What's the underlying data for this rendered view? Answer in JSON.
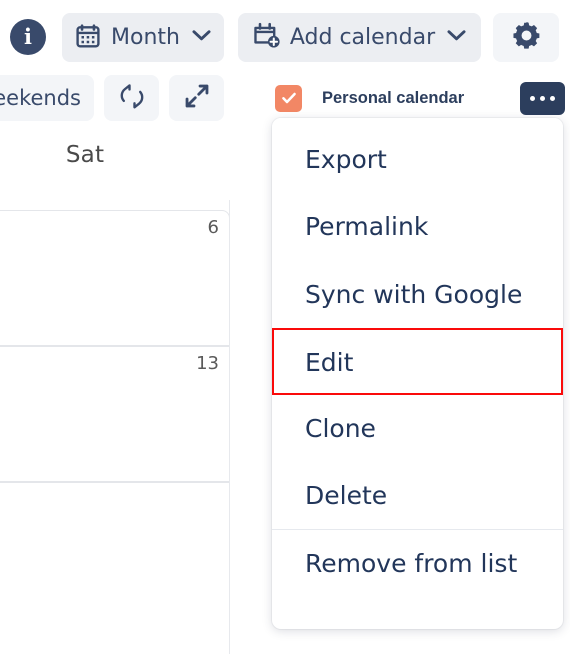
{
  "toolbar": {
    "info_icon": "info-circle-icon",
    "view_button": {
      "label": "Month",
      "icon": "calendar-icon",
      "chevron": "chevron-down-icon"
    },
    "add_calendar_button": {
      "label": "Add calendar",
      "icon": "calendar-plus-icon",
      "chevron": "chevron-down-icon"
    },
    "settings_button": {
      "icon": "gear-icon"
    },
    "weekends_button": {
      "label": "eekends"
    },
    "refresh_button": {
      "icon": "refresh-icon"
    },
    "fullscreen_button": {
      "icon": "expand-arrows-icon"
    }
  },
  "calendar_list": {
    "item": {
      "name": "Personal calendar",
      "checked": true,
      "checkbox_color": "#f28765",
      "more_button_color": "#2c3e5d",
      "more_icon": "ellipsis-icon"
    }
  },
  "context_menu": {
    "items": [
      {
        "label": "Export",
        "highlighted": false,
        "divider_above": false
      },
      {
        "label": "Permalink",
        "highlighted": false,
        "divider_above": false
      },
      {
        "label": "Sync with Google",
        "highlighted": false,
        "divider_above": false
      },
      {
        "label": "Edit",
        "highlighted": true,
        "divider_above": true
      },
      {
        "label": "Clone",
        "highlighted": false,
        "divider_above": false
      },
      {
        "label": "Delete",
        "highlighted": false,
        "divider_above": false
      },
      {
        "label": "Remove from list",
        "highlighted": false,
        "divider_above": true
      }
    ],
    "highlight_color": "#fa0a0a"
  },
  "calendar_grid": {
    "day_header": "Sat",
    "day_numbers": [
      "6",
      "13"
    ]
  }
}
